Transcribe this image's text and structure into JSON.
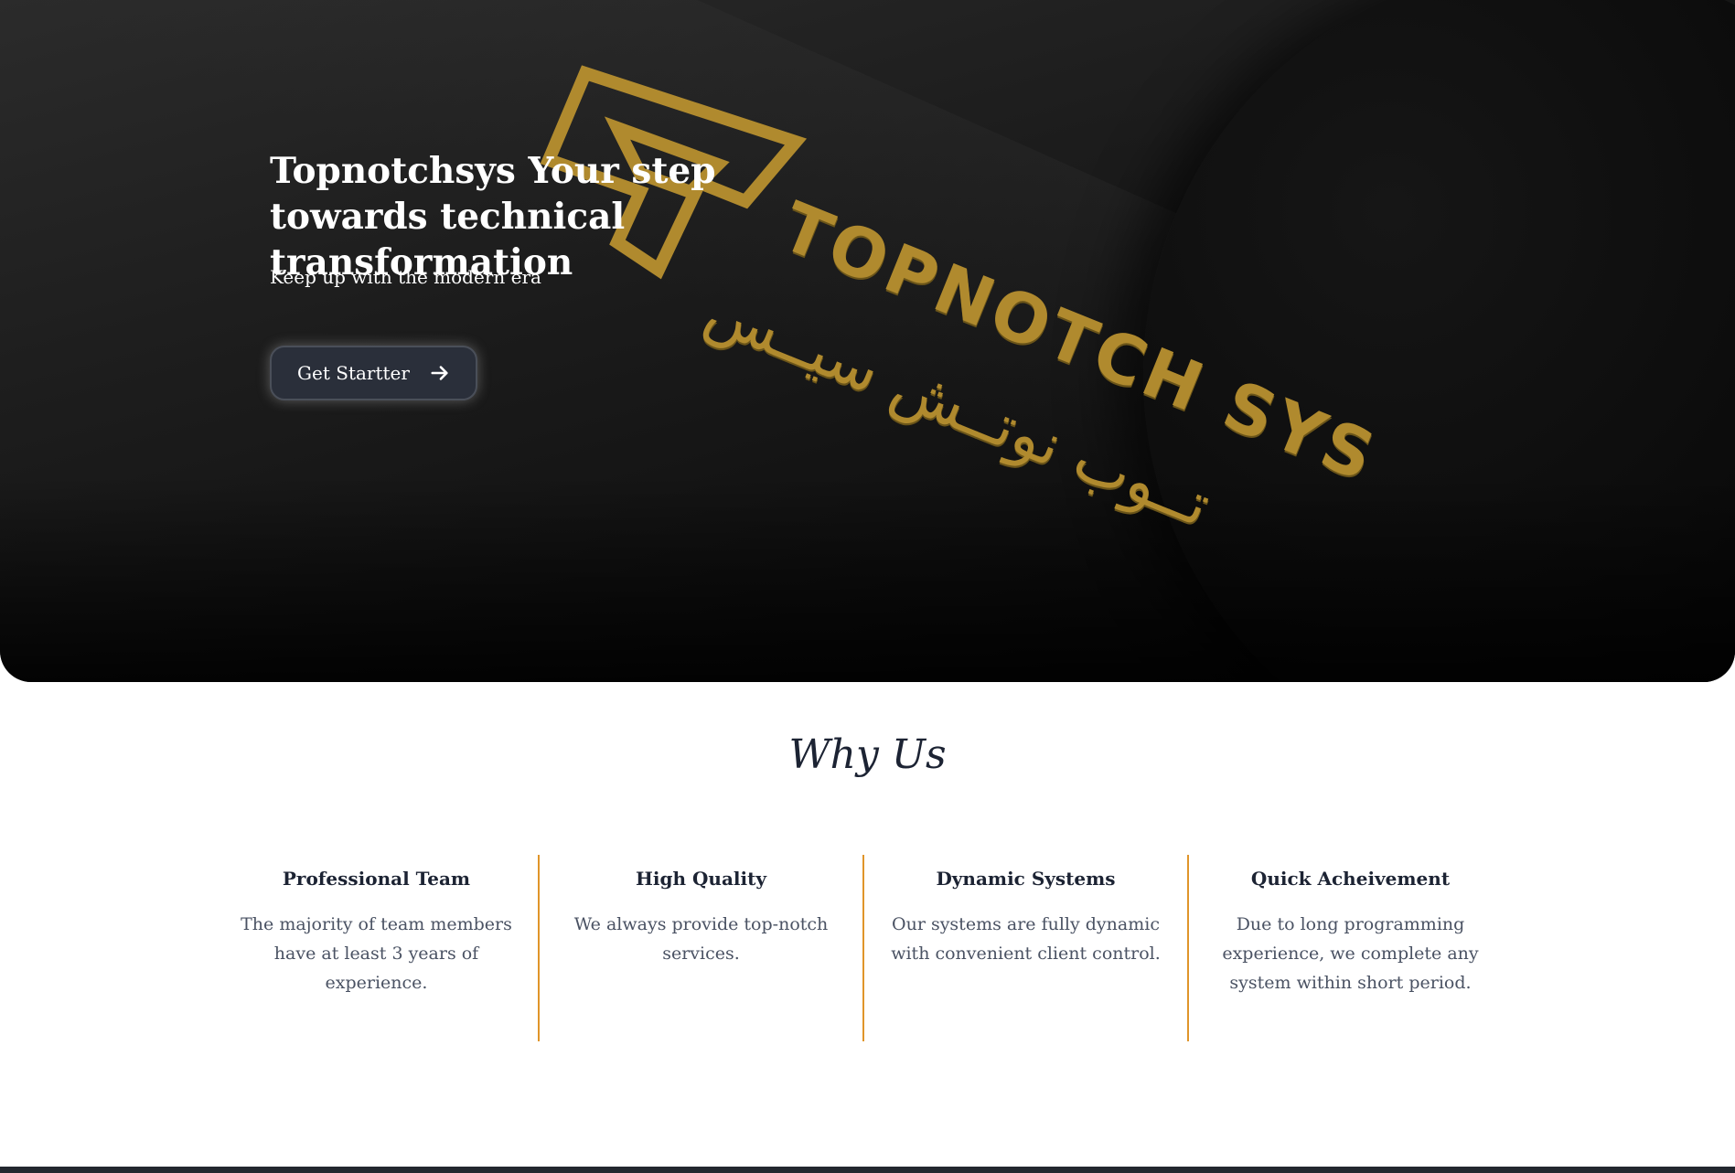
{
  "hero": {
    "title": "Topnotchsys Your step towards technical transformation",
    "subtitle": "Keep up with the modern era",
    "cta_label": "Get Startter",
    "logo_text_en": "TOPNOTCH SYS",
    "logo_text_ar": "تــوب نوتــش سيــس"
  },
  "why": {
    "title": "Why Us",
    "features": [
      {
        "title": "Professional Team",
        "text": "The majority of team members have at least 3 years of experience."
      },
      {
        "title": "High Quality",
        "text": "We always provide top-notch services."
      },
      {
        "title": "Dynamic Systems",
        "text": "Our systems are fully dynamic with convenient client control."
      },
      {
        "title": "Quick Acheivement",
        "text": "Due to long programming experience, we complete any system within short period."
      }
    ]
  },
  "colors": {
    "accent_divider": "#e0952a",
    "gold_logo": "#b08a2e",
    "button_bg": "#2a2f3a",
    "heading_dark": "#1c2333"
  },
  "icons": {
    "cta_icon": "arrow-right-icon"
  }
}
